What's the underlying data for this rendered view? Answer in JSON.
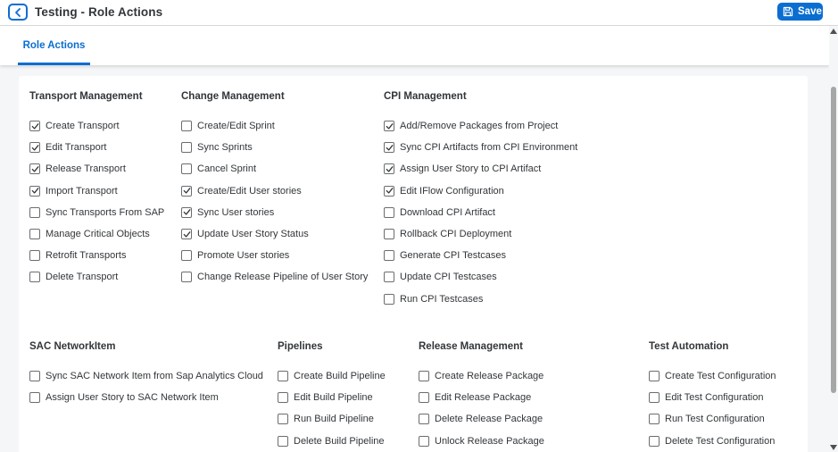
{
  "header": {
    "title": "Testing - Role Actions",
    "save_label": "Save"
  },
  "tabs": [
    {
      "label": "Role Actions"
    }
  ],
  "colors": {
    "accent": "#0a6ed1",
    "text": "#32363a",
    "background": "#f5f6f7"
  },
  "groups": [
    {
      "title": "Transport Management",
      "items": [
        {
          "label": "Create Transport",
          "checked": true
        },
        {
          "label": "Edit Transport",
          "checked": true
        },
        {
          "label": "Release Transport",
          "checked": true
        },
        {
          "label": "Import Transport",
          "checked": true
        },
        {
          "label": "Sync Transports From SAP",
          "checked": false
        },
        {
          "label": "Manage Critical Objects",
          "checked": false
        },
        {
          "label": "Retrofit Transports",
          "checked": false
        },
        {
          "label": "Delete Transport",
          "checked": false
        }
      ]
    },
    {
      "title": "Change Management",
      "items": [
        {
          "label": "Create/Edit Sprint",
          "checked": false
        },
        {
          "label": "Sync Sprints",
          "checked": false
        },
        {
          "label": "Cancel Sprint",
          "checked": false
        },
        {
          "label": "Create/Edit User stories",
          "checked": true
        },
        {
          "label": "Sync User stories",
          "checked": true
        },
        {
          "label": "Update User Story Status",
          "checked": true
        },
        {
          "label": "Promote User stories",
          "checked": false
        },
        {
          "label": "Change Release Pipeline of User Story",
          "checked": false
        }
      ]
    },
    {
      "title": "CPI Management",
      "items": [
        {
          "label": "Add/Remove Packages from Project",
          "checked": true
        },
        {
          "label": "Sync CPI Artifacts from CPI Environment",
          "checked": true
        },
        {
          "label": "Assign User Story to CPI Artifact",
          "checked": true
        },
        {
          "label": "Edit IFlow Configuration",
          "checked": true
        },
        {
          "label": "Download CPI Artifact",
          "checked": false
        },
        {
          "label": "Rollback CPI Deployment",
          "checked": false
        },
        {
          "label": "Generate CPI Testcases",
          "checked": false
        },
        {
          "label": "Update CPI Testcases",
          "checked": false
        },
        {
          "label": "Run CPI Testcases",
          "checked": false
        }
      ]
    },
    {
      "title": "SAC NetworkItem",
      "items": [
        {
          "label": "Sync SAC Network Item from Sap Analytics Cloud",
          "checked": false
        },
        {
          "label": "Assign User Story to SAC Network Item",
          "checked": false
        }
      ]
    },
    {
      "title": "Pipelines",
      "items": [
        {
          "label": "Create Build Pipeline",
          "checked": false
        },
        {
          "label": "Edit Build Pipeline",
          "checked": false
        },
        {
          "label": "Run Build Pipeline",
          "checked": false
        },
        {
          "label": "Delete Build Pipeline",
          "checked": false
        }
      ]
    },
    {
      "title": "Release Management",
      "items": [
        {
          "label": "Create Release Package",
          "checked": false
        },
        {
          "label": "Edit Release Package",
          "checked": false
        },
        {
          "label": "Delete Release Package",
          "checked": false
        },
        {
          "label": "Unlock Release Package",
          "checked": false
        }
      ]
    },
    {
      "title": "Test Automation",
      "items": [
        {
          "label": "Create Test Configuration",
          "checked": false
        },
        {
          "label": "Edit Test Configuration",
          "checked": false
        },
        {
          "label": "Run Test Configuration",
          "checked": false
        },
        {
          "label": "Delete Test Configuration",
          "checked": false
        }
      ]
    }
  ]
}
